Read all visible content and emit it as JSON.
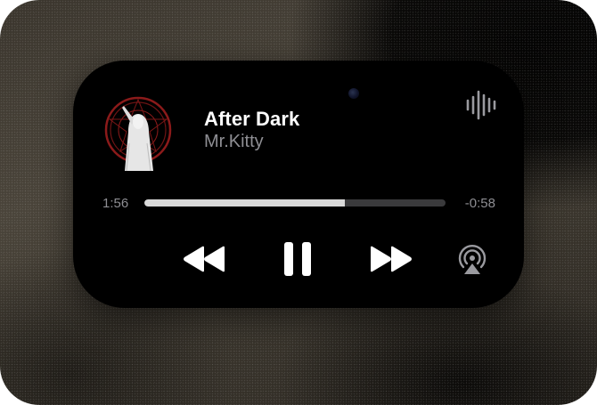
{
  "now_playing": {
    "title": "After Dark",
    "artist": "Mr.Kitty",
    "elapsed": "1:56",
    "remaining": "-0:58",
    "progress": 0.667
  },
  "icons": {
    "artwork": "album-art-icon",
    "waveform": "waveform-icon",
    "rewind": "rewind-icon",
    "pause": "pause-icon",
    "fast_forward": "fast-forward-icon",
    "airplay": "airplay-icon"
  },
  "colors": {
    "island": "#000000",
    "title": "#ffffff",
    "secondary": "#8e8e93",
    "track": "#3a3a3c",
    "progress": "#d9d9d9",
    "art_accent": "#8b1a1a"
  }
}
